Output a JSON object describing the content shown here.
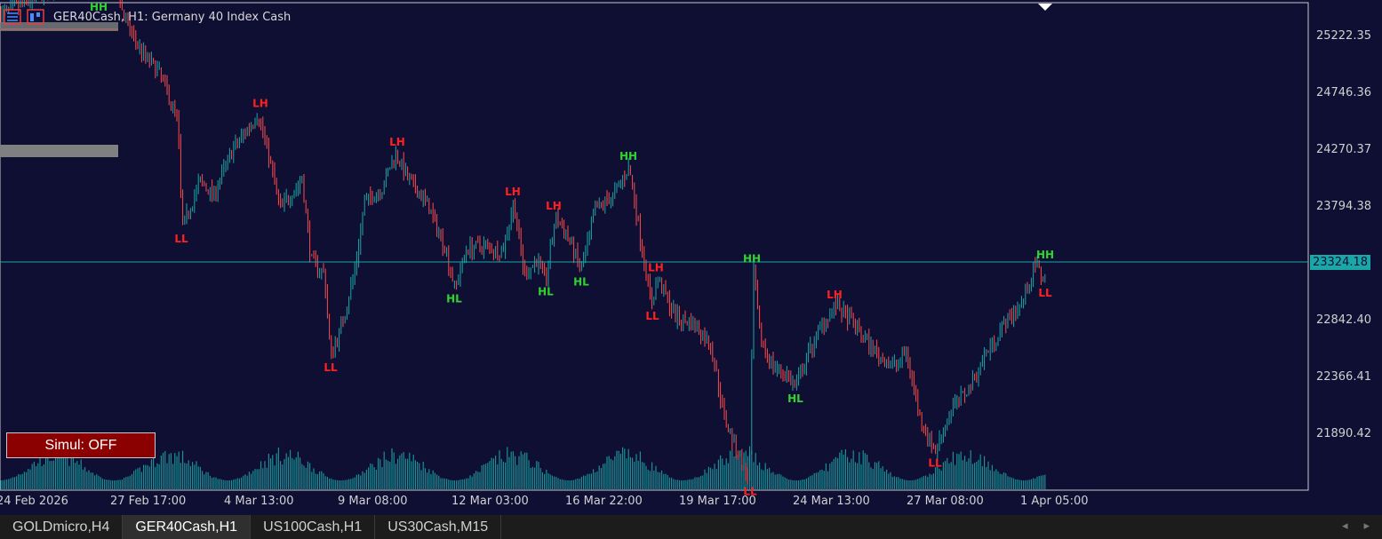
{
  "window": {
    "title": "GER40Cash, H1:  Germany 40 Index Cash",
    "current_price": "23324.18"
  },
  "icons": [
    "chart-list-icon",
    "chart-window-icon",
    "triangle-marker-icon"
  ],
  "colors": {
    "background": "#0f0f33",
    "bull": "#1aa7a7",
    "bear": "#ff4b4b",
    "label_high": "#2fd42f",
    "label_low": "#ff2020",
    "simul_button": "#8b0000"
  },
  "price_axis": [
    "25222.35",
    "24746.36",
    "24270.37",
    "23794.38",
    "23324.18",
    "22842.40",
    "22366.41",
    "21890.42"
  ],
  "time_axis": [
    "24 Feb 2026",
    "27 Feb 17:00",
    "4 Mar 13:00",
    "9 Mar 08:00",
    "12 Mar 03:00",
    "16 Mar 22:00",
    "19 Mar 17:00",
    "24 Mar 13:00",
    "27 Mar 08:00",
    "1 Apr 05:00"
  ],
  "simul_button": "Simul: OFF",
  "tabs": [
    {
      "label": "GOLDmicro,H4",
      "active": false
    },
    {
      "label": "GER40Cash,H1",
      "active": true
    },
    {
      "label": "US100Cash,H1",
      "active": false
    },
    {
      "label": "US30Cash,M15",
      "active": false
    }
  ],
  "chart_data": {
    "type": "candlestick",
    "symbol": "GER40Cash",
    "timeframe": "H1",
    "price_range": [
      21500,
      25480
    ],
    "current_price": 23324.18,
    "swing_points": [
      {
        "label": "HH",
        "price": 25420
      },
      {
        "label": "LL",
        "price": 23620
      },
      {
        "label": "LH",
        "price": 24420
      },
      {
        "label": "LL",
        "price": 22720
      },
      {
        "label": "LH",
        "price": 24150
      },
      {
        "label": "HL",
        "price": 23200
      },
      {
        "label": "LH",
        "price": 23800
      },
      {
        "label": "HL",
        "price": 23250
      },
      {
        "label": "LH",
        "price": 23700
      },
      {
        "label": "HL",
        "price": 23320
      },
      {
        "label": "HH",
        "price": 24050
      },
      {
        "label": "LH",
        "price": 23270
      },
      {
        "label": "LL",
        "price": 23080
      },
      {
        "label": "HH",
        "price": 23330
      },
      {
        "label": "LL",
        "price": 21850
      },
      {
        "label": "LH",
        "price": 23080
      },
      {
        "label": "HL",
        "price": 22500
      },
      {
        "label": "LL",
        "price": 22050
      },
      {
        "label": "HH",
        "price": 23360
      },
      {
        "label": "LL",
        "price": 23240
      }
    ]
  }
}
